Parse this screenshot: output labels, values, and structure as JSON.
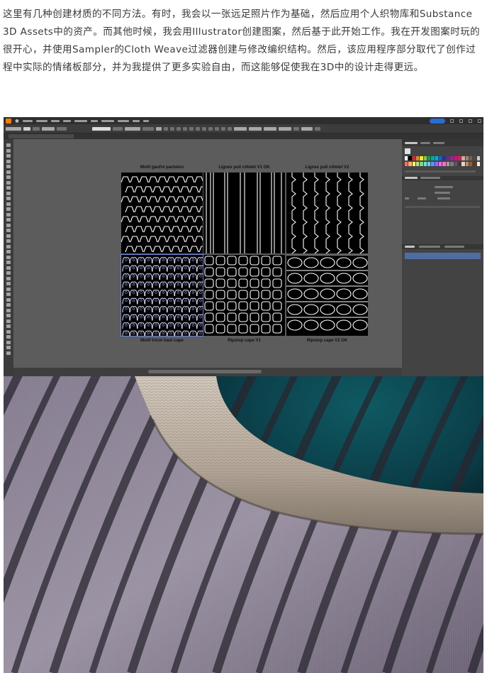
{
  "article": {
    "paragraph": "这里有几种创建材质的不同方法。有时，我会以一张远足照片作为基础，然后应用个人织物库和Substance 3D Assets中的资产。而其他时候，我会用Illustrator创建图案，然后基于此开始工作。我在开发图案时玩的很开心，并使用Sampler的Cloth Weave过滤器创建与修改编织结构。然后，该应用程序部分取代了创作过程中实际的情绪板部分，并为我提供了更多实验自由，而这能够促使我在3D中的设计走得更远。"
  },
  "illustrator": {
    "app_icon": "illustrator-logo-icon",
    "artboards": [
      {
        "label": "Motif gaufré pantalon",
        "pattern": "waffle-arches"
      },
      {
        "label": "Lignes pull côtelet V1 OK",
        "pattern": "vertical-ribs"
      },
      {
        "label": "Lignes pull côtelet V2",
        "pattern": "wavy-ribs"
      },
      {
        "label": "Motif tricot haut cape",
        "pattern": "knit-loops",
        "selected": true
      },
      {
        "label": "Ripstop cape V1",
        "pattern": "ripstop-grid"
      },
      {
        "label": "Ripstop cape V2 OK",
        "pattern": "ripstop-ovals"
      }
    ],
    "colors": {
      "canvas": "#5c5c5c",
      "panel": "#434343",
      "selection": "#6d86d9",
      "pattern_bg": "#000000",
      "pattern_line": "#ffffff"
    }
  },
  "render": {
    "subject": "knit-fabric-render",
    "colors": {
      "rib_light": "#9b93a3",
      "rib_dark": "#2a2530",
      "band": "#bdb2a6",
      "background_teal": "#0f5a63"
    }
  }
}
